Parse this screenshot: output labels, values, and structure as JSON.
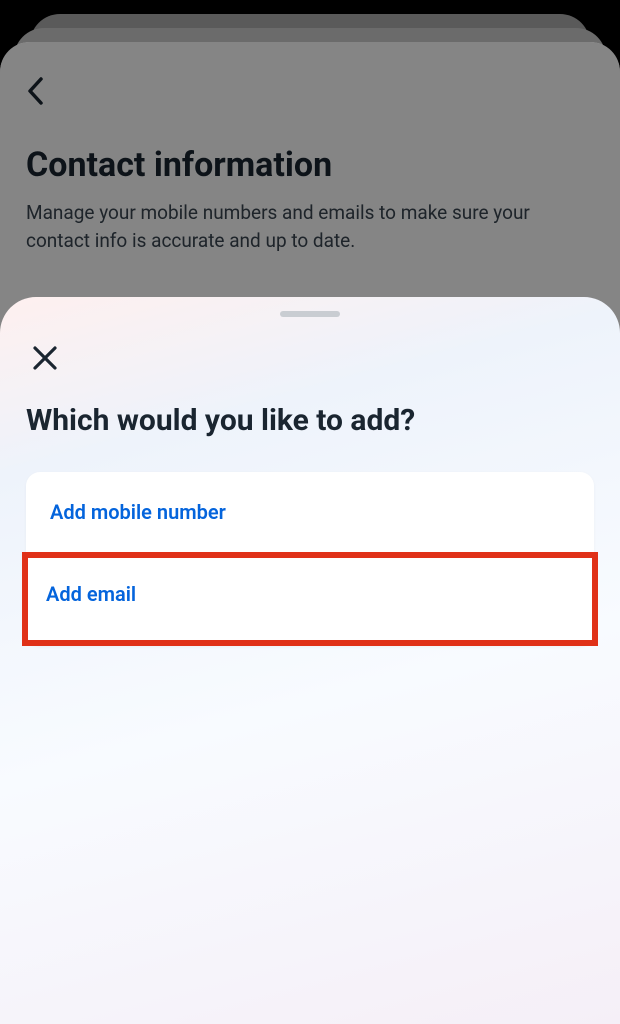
{
  "background": {
    "title": "Contact information",
    "subtitle": "Manage your mobile numbers and emails to make sure your contact info is accurate and up to date."
  },
  "sheet": {
    "title": "Which would you like to add?",
    "options": {
      "mobile": "Add mobile number",
      "email": "Add email"
    }
  }
}
